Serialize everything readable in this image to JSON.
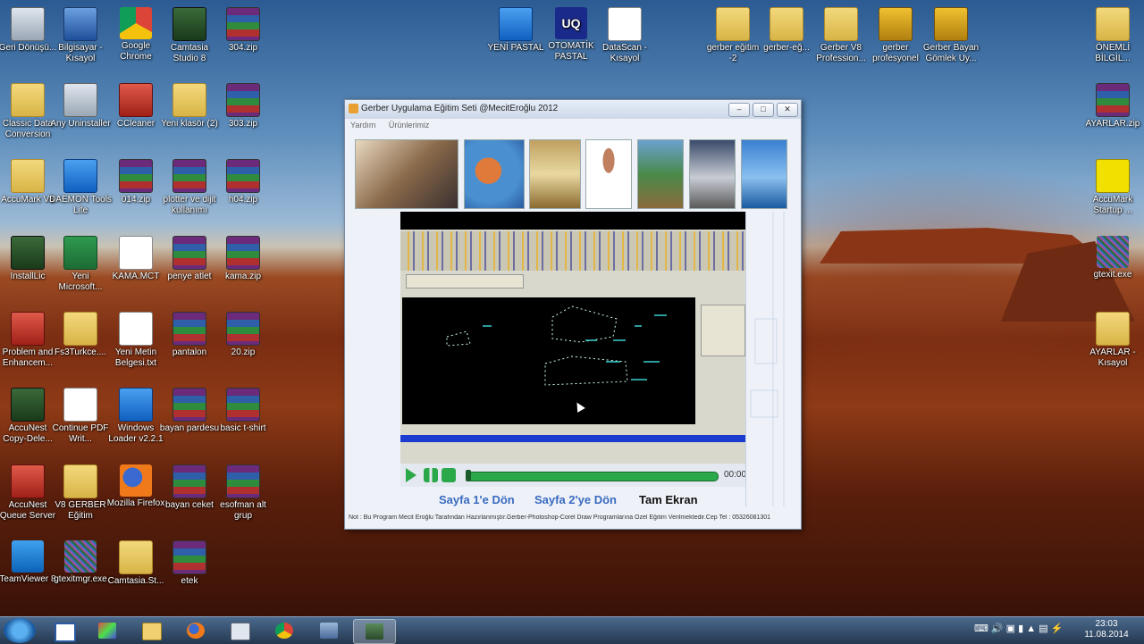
{
  "desktop": {
    "icons": [
      {
        "label": "Geri Dönüşü...",
        "icon": "recycle-bin-icon",
        "glyph": "bin"
      },
      {
        "label": "Bilgisayar - Kısayol",
        "icon": "computer-icon",
        "glyph": "pc"
      },
      {
        "label": "Google Chrome",
        "icon": "chrome-icon",
        "glyph": "chrome"
      },
      {
        "label": "Camtasia Studio 8",
        "icon": "camtasia-icon",
        "glyph": "app"
      },
      {
        "label": "304.zip",
        "icon": "winrar-icon",
        "glyph": "rar"
      },
      {
        "label": "Classic Data Conversion",
        "icon": "folder-icon",
        "glyph": "folder"
      },
      {
        "label": "Any Uninstaller",
        "icon": "uninstaller-icon",
        "glyph": "bin"
      },
      {
        "label": "CCleaner",
        "icon": "ccleaner-icon",
        "glyph": "red"
      },
      {
        "label": "Yeni klasör (2)",
        "icon": "folder-icon",
        "glyph": "folder"
      },
      {
        "label": "303.zip",
        "icon": "winrar-icon",
        "glyph": "rar"
      },
      {
        "label": "AccuMark V8",
        "icon": "folder-icon",
        "glyph": "folder"
      },
      {
        "label": "DAEMON Tools Lite",
        "icon": "daemon-tools-icon",
        "glyph": "blue"
      },
      {
        "label": "014.zip",
        "icon": "winrar-icon",
        "glyph": "rar"
      },
      {
        "label": "plotter ve dijit kullanımı",
        "icon": "winrar-icon",
        "glyph": "rar"
      },
      {
        "label": "h04.zip",
        "icon": "winrar-icon",
        "glyph": "rar"
      },
      {
        "label": "InstallLic",
        "icon": "installer-icon",
        "glyph": "app"
      },
      {
        "label": "Yeni Microsoft...",
        "icon": "excel-icon",
        "glyph": "excel"
      },
      {
        "label": "KAMA.MCT",
        "icon": "document-icon",
        "glyph": "doc"
      },
      {
        "label": "penye atlet",
        "icon": "winrar-icon",
        "glyph": "rar"
      },
      {
        "label": "kama.zip",
        "icon": "winrar-icon",
        "glyph": "rar"
      },
      {
        "label": "Problem and Enhancem...",
        "icon": "problem-report-icon",
        "glyph": "red"
      },
      {
        "label": "Fs3Turkce....",
        "icon": "folder-icon",
        "glyph": "folder"
      },
      {
        "label": "Yeni Metin Belgesi.txt",
        "icon": "text-file-icon",
        "glyph": "doc"
      },
      {
        "label": "pantalon",
        "icon": "winrar-icon",
        "glyph": "rar"
      },
      {
        "label": "20.zip",
        "icon": "winrar-icon",
        "glyph": "rar"
      },
      {
        "label": "AccuNest Copy-Dele...",
        "icon": "accunest-icon",
        "glyph": "app"
      },
      {
        "label": "Continue PDF Writ...",
        "icon": "pdf-writer-icon",
        "glyph": "doc"
      },
      {
        "label": "Windows Loader v2.2.1",
        "icon": "windows-loader-icon",
        "glyph": "blue"
      },
      {
        "label": "bayan pardesu",
        "icon": "winrar-icon",
        "glyph": "rar"
      },
      {
        "label": "basic t-shirt",
        "icon": "winrar-icon",
        "glyph": "rar"
      },
      {
        "label": "AccuNest Queue Server",
        "icon": "accunest-icon",
        "glyph": "red"
      },
      {
        "label": "V8 GERBER Eğitim",
        "icon": "folder-icon",
        "glyph": "folder"
      },
      {
        "label": "Mozilla Firefox",
        "icon": "firefox-icon",
        "glyph": "firefox"
      },
      {
        "label": "bayan ceket",
        "icon": "winrar-icon",
        "glyph": "rar"
      },
      {
        "label": "esofman alt grup",
        "icon": "winrar-icon",
        "glyph": "rar"
      },
      {
        "label": "TeamViewer 8",
        "icon": "teamviewer-icon",
        "glyph": "tv"
      },
      {
        "label": "gtexitmgr.exe",
        "icon": "exe-icon",
        "glyph": "noise"
      },
      {
        "label": "Camtasia.St...",
        "icon": "folder-icon",
        "glyph": "folder"
      },
      {
        "label": "etek",
        "icon": "winrar-icon",
        "glyph": "rar"
      },
      {
        "label": "YENİ PASTAL",
        "icon": "pastal-icon",
        "glyph": "blue"
      },
      {
        "label": "OTOMATİK PASTAL",
        "icon": "uq-icon",
        "glyph": "uq"
      },
      {
        "label": "DataScan - Kısayol",
        "icon": "datascan-icon",
        "glyph": "doc"
      },
      {
        "label": "gerber eğitim -2",
        "icon": "folder-icon",
        "glyph": "folder"
      },
      {
        "label": "gerber-eğ...",
        "icon": "folder-icon",
        "glyph": "folder"
      },
      {
        "label": "Gerber V8 Profession...",
        "icon": "folder-icon",
        "glyph": "folder"
      },
      {
        "label": "gerber profesyonel",
        "icon": "gerber-icon",
        "glyph": "gear"
      },
      {
        "label": "Gerber Bayan Gömlek Uy...",
        "icon": "gerber-icon",
        "glyph": "gear"
      },
      {
        "label": "ÖNEMLİ BİLGİL...",
        "icon": "folder-icon",
        "glyph": "folder"
      },
      {
        "label": "AYARLAR.zip",
        "icon": "winrar-icon",
        "glyph": "rar"
      },
      {
        "label": "AccuMark Startup ...",
        "icon": "accumark-icon",
        "glyph": "yellow"
      },
      {
        "label": "gtexit.exe",
        "icon": "exe-icon",
        "glyph": "noise"
      },
      {
        "label": "AYARLAR - Kısayol",
        "icon": "folder-icon",
        "glyph": "folder"
      }
    ]
  },
  "window": {
    "title": "Gerber Uygulama Eğitim Seti @MecitEroğlu 2012",
    "menu": [
      "Yardım",
      "Ürünlerimiz"
    ],
    "photos": [
      "photo-business-meeting",
      "photo-balloons",
      "photo-living-room",
      "photo-woman",
      "photo-cyclist",
      "photo-jet",
      "photo-sailboat"
    ],
    "player": {
      "time": "00:00",
      "progress": 0.0
    },
    "links": [
      "Sayfa 1'e Dön",
      "Sayfa 2'ye Dön",
      "Tam Ekran"
    ],
    "note": "Not : Bu Program Mecit Eroğlu Tarafından Hazırlanmıştır.Gerber-Photoshop-Corel Draw Programlarına Özel Eğitim Verilmektedir.Cep Tel : 05326081301",
    "colors": {
      "link": "#3a6ac0",
      "link_active": "#111111",
      "play": "#2aa84a"
    }
  },
  "taskbar": {
    "items": [
      {
        "name": "start-button",
        "icon": "windows-logo-icon"
      },
      {
        "name": "taskbar-explorer",
        "icon": "window-icon"
      },
      {
        "name": "taskbar-gtexit",
        "icon": "palette-icon"
      },
      {
        "name": "taskbar-folder",
        "icon": "folder-icon"
      },
      {
        "name": "taskbar-firefox",
        "icon": "firefox-icon"
      },
      {
        "name": "taskbar-calculator",
        "icon": "calculator-icon"
      },
      {
        "name": "taskbar-chrome",
        "icon": "chrome-icon"
      },
      {
        "name": "taskbar-app",
        "icon": "app-icon"
      },
      {
        "name": "taskbar-gerber-training",
        "icon": "gerber-icon"
      }
    ],
    "clock_time": "23:03",
    "clock_date": "11.08.2014"
  }
}
